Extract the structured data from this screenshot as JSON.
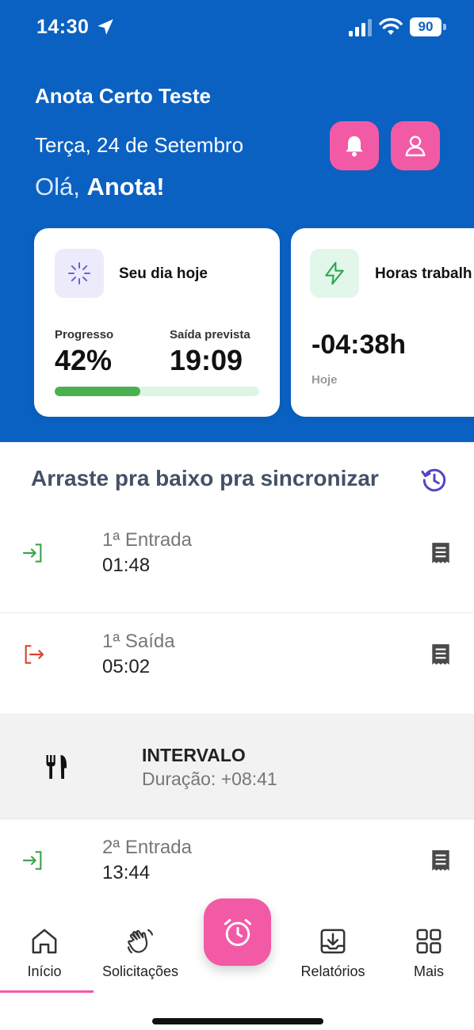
{
  "status_bar": {
    "time": "14:30",
    "battery": "90"
  },
  "header": {
    "company": "Anota Certo Teste",
    "date": "Terça, 24 de Setembro",
    "greeting_prefix": "Olá,",
    "greeting_name": "Anota!"
  },
  "card_day": {
    "title": "Seu dia hoje",
    "progress_label": "Progresso",
    "progress_value": "42%",
    "progress_fraction": 0.42,
    "exit_label": "Saída prevista",
    "exit_value": "19:09"
  },
  "card_hours": {
    "title": "Horas trabalh",
    "value": "-04:38h",
    "sub": "Hoje"
  },
  "sync": {
    "text": "Arraste pra baixo pra sincronizar"
  },
  "entries": [
    {
      "label": "1ª Entrada",
      "time": "01:48"
    },
    {
      "label": "1ª Saída",
      "time": "05:02"
    },
    {
      "label": "2ª Entrada",
      "time": "13:44"
    }
  ],
  "interval": {
    "title": "INTERVALO",
    "duration": "Duração: +08:41"
  },
  "tabs": [
    {
      "label": "Início",
      "icon": "home-icon"
    },
    {
      "label": "Solicitações",
      "icon": "hand-wave-icon"
    },
    {
      "label": "Relatórios",
      "icon": "download-icon"
    },
    {
      "label": "Mais",
      "icon": "grid-icon"
    }
  ],
  "colors": {
    "primary": "#0a61c2",
    "accent": "#f25aa6",
    "success": "#4caf50",
    "danger": "#d9534f"
  }
}
